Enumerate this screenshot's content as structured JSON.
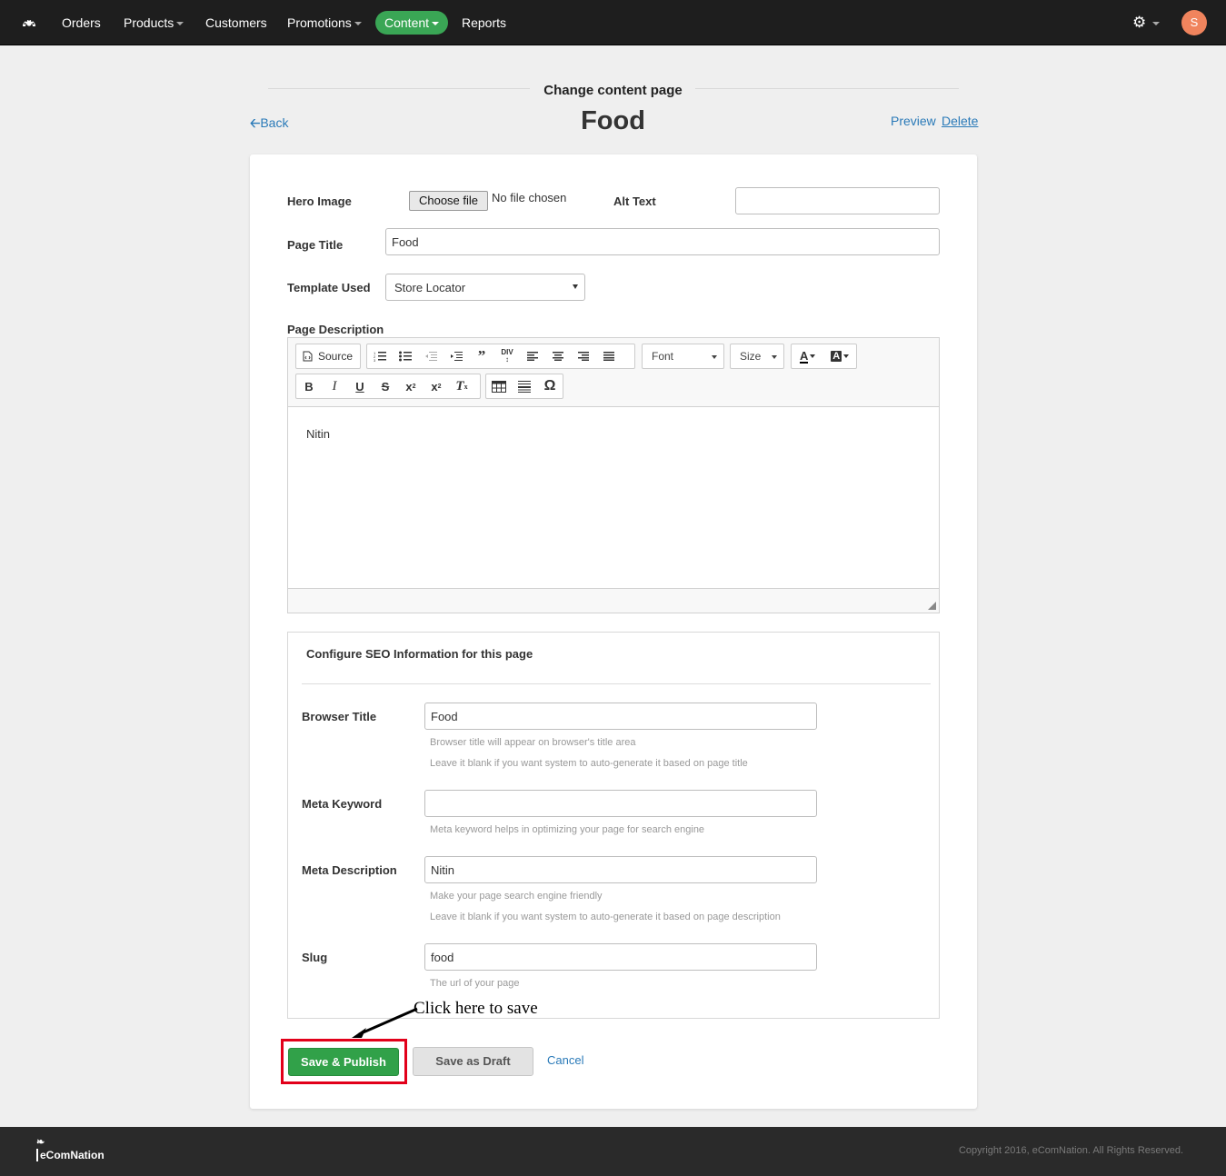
{
  "nav": {
    "items": [
      "Orders",
      "Products",
      "Customers",
      "Promotions",
      "Content",
      "Reports"
    ],
    "active": "Content",
    "avatar_letter": "S",
    "accent_color": "#3aa655"
  },
  "header": {
    "subtitle": "Change content page",
    "title": "Food",
    "back_label": "Back",
    "preview_label": "Preview",
    "delete_label": "Delete"
  },
  "form": {
    "hero_image_label": "Hero Image",
    "choose_file_label": "Choose file",
    "no_file_text": "No file chosen",
    "alt_text_label": "Alt Text",
    "alt_text_value": "",
    "page_title_label": "Page Title",
    "page_title_value": "Food",
    "template_label": "Template Used",
    "template_value": "Store Locator",
    "description_label": "Page Description"
  },
  "editor": {
    "source_label": "Source",
    "font_label": "Font",
    "size_label": "Size",
    "content": "Nitin"
  },
  "seo": {
    "title": "Configure SEO Information for this page",
    "browser_title_label": "Browser Title",
    "browser_title_value": "Food",
    "browser_title_help1": "Browser title will appear on browser's title area",
    "browser_title_help2": "Leave it blank if you want system to auto-generate it based on page title",
    "meta_keyword_label": "Meta Keyword",
    "meta_keyword_value": "",
    "meta_keyword_help": "Meta keyword helps in optimizing your page for search engine",
    "meta_description_label": "Meta Description",
    "meta_description_value": "Nitin",
    "meta_description_help1": "Make your page search engine friendly",
    "meta_description_help2": "Leave it blank if you want system to auto-generate it based on page description",
    "slug_label": "Slug",
    "slug_value": "food",
    "slug_help": "The url of your page"
  },
  "actions": {
    "save_publish_label": "Save & Publish",
    "save_draft_label": "Save as Draft",
    "cancel_label": "Cancel",
    "annotation": "Click here to save",
    "save_color": "#31a149",
    "highlight_color": "#e2001a"
  },
  "footer": {
    "logo_text": "eComNation",
    "copyright": "Copyright 2016, eComNation. All Rights Reserved."
  }
}
